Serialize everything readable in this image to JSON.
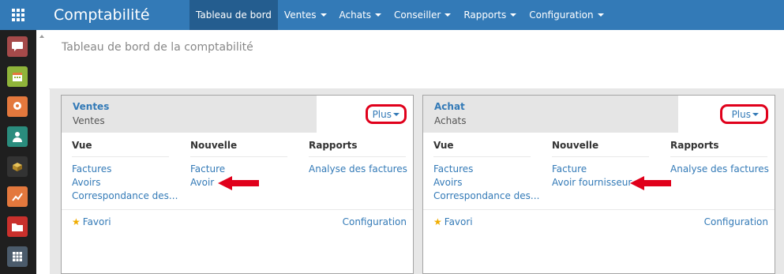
{
  "app": {
    "title": "Comptabilité"
  },
  "menu": [
    {
      "label": "Tableau de bord",
      "active": true,
      "dropdown": false
    },
    {
      "label": "Ventes",
      "active": false,
      "dropdown": true
    },
    {
      "label": "Achats",
      "active": false,
      "dropdown": true
    },
    {
      "label": "Conseiller",
      "active": false,
      "dropdown": true
    },
    {
      "label": "Rapports",
      "active": false,
      "dropdown": true
    },
    {
      "label": "Configuration",
      "active": false,
      "dropdown": true
    }
  ],
  "dock": [
    {
      "icon": "discuss-icon",
      "color": "#a54a4a"
    },
    {
      "icon": "calendar-icon",
      "color": "#8fb43a"
    },
    {
      "icon": "crm-icon",
      "color": "#e3783d"
    },
    {
      "icon": "contacts-icon",
      "color": "#2a8c7d"
    },
    {
      "icon": "inventory-icon",
      "color": "#333333"
    },
    {
      "icon": "accounting-icon",
      "color": "#e3783d"
    },
    {
      "icon": "documents-icon",
      "color": "#c9302c"
    },
    {
      "icon": "spreadsheet-icon",
      "color": "#4b5b6b"
    }
  ],
  "page": {
    "title": "Tableau de bord de la comptabilité"
  },
  "cards": [
    {
      "title": "Ventes",
      "subtitle": "Ventes",
      "more_label": "Plus",
      "view_head": "Vue",
      "new_head": "Nouvelle",
      "reports_head": "Rapports",
      "view_links": [
        "Factures",
        "Avoirs",
        "Correspondance des..."
      ],
      "new_links": [
        "Facture",
        "Avoir"
      ],
      "report_links": [
        "Analyse des factures"
      ],
      "favorite_label": "Favori",
      "config_label": "Configuration"
    },
    {
      "title": "Achat",
      "subtitle": "Achats",
      "more_label": "Plus",
      "view_head": "Vue",
      "new_head": "Nouvelle",
      "reports_head": "Rapports",
      "view_links": [
        "Factures",
        "Avoirs",
        "Correspondance des..."
      ],
      "new_links": [
        "Facture",
        "Avoir fournisseur"
      ],
      "report_links": [
        "Analyse des factures"
      ],
      "favorite_label": "Favori",
      "config_label": "Configuration"
    }
  ],
  "colors": {
    "navbar": "#337ab7",
    "navbar_active": "#245d8f",
    "link": "#337ab7",
    "highlight": "#e0001b",
    "dock": "#1f1f1f"
  }
}
